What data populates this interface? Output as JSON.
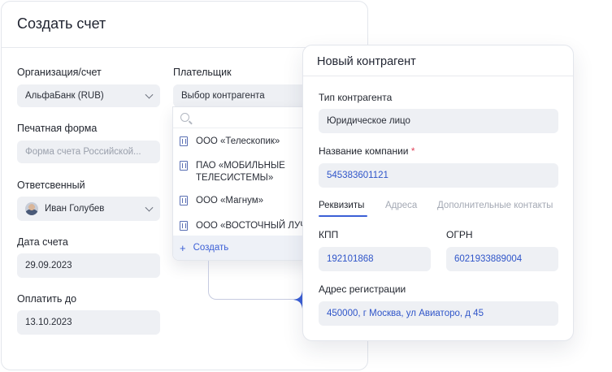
{
  "invoice": {
    "title": "Создать счет",
    "org_label": "Организация/счет",
    "org_value": "АльфаБанк (RUB)",
    "print_form_label": "Печатная форма",
    "print_form_placeholder": "Форма счета Российской...",
    "responsible_label": "Ответсвенный",
    "responsible_value": "Иван Голубев",
    "date_label": "Дата счета",
    "date_value": "29.09.2023",
    "pay_until_label": "Оплатить до",
    "pay_until_value": "13.10.2023",
    "payer_label": "Плательщик",
    "payer_placeholder": "Выбор контрагента"
  },
  "dropdown": {
    "items": [
      {
        "label": "ООО «Телескопик»"
      },
      {
        "label": "ПАО «МОБИЛЬНЫЕ"
      },
      {
        "label": "ТЕЛЕСИСТЕМЫ»"
      },
      {
        "label": "ООО «Магнум»"
      },
      {
        "label": "ООО «ВОСТОЧНЫЙ ЛУЧ"
      }
    ],
    "create_label": "Создать"
  },
  "counterparty": {
    "title": "Новый контрагент",
    "type_label": "Тип контрагента",
    "type_value": "Юридическое лицо",
    "company_label": "Название компании",
    "required_mark": "*",
    "company_value": "545383601121",
    "tabs": [
      {
        "label": "Реквизиты"
      },
      {
        "label": "Адреса"
      },
      {
        "label": "Дополнительные контакты"
      }
    ],
    "kpp_label": "КПП",
    "kpp_value": "192101868",
    "ogrn_label": "ОГРН",
    "ogrn_value": "6021933889004",
    "address_label": "Адрес регистрации",
    "address_value": "450000, г Москва, ул Авиаторо, д 45"
  },
  "colors": {
    "accent": "#3b5fd6",
    "field_bg": "#eef0f4",
    "required": "#e0445a"
  }
}
